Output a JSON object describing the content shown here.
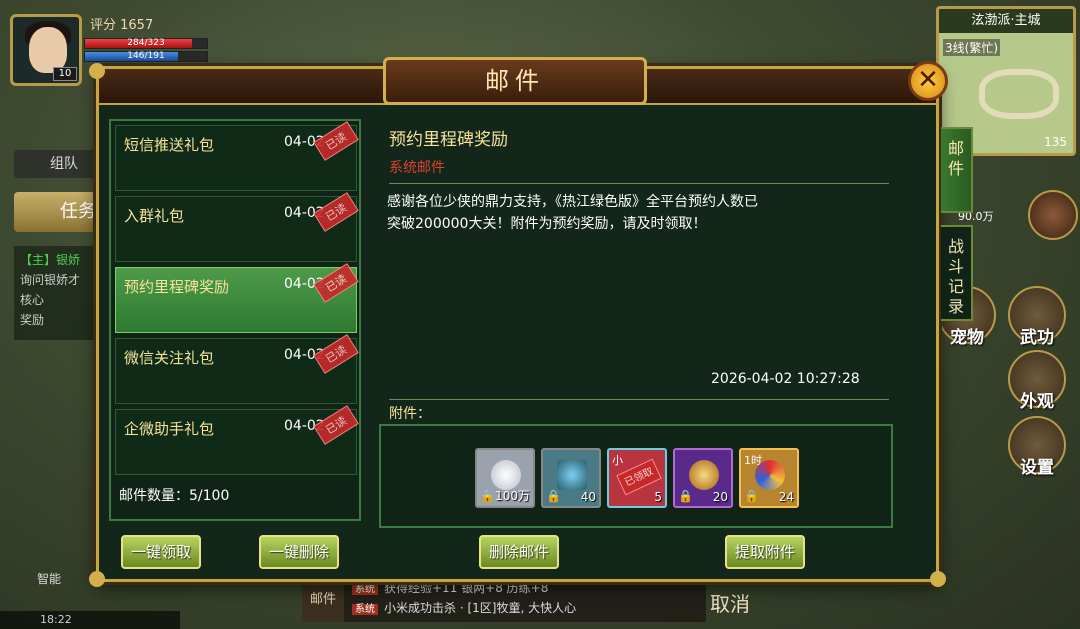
{
  "hud": {
    "score": "评分 1657",
    "hp": "284/323",
    "mp": "146/191",
    "level": "10",
    "team_tab": "组队",
    "quest_tab": "任务",
    "quest_line1_tag": "【主】银娇",
    "quest_line2": "询问银娇才",
    "quest_line3": "核心",
    "quest_line4": "奖励",
    "auto_label": "智能",
    "time": "18:22",
    "chat_tab": "邮件",
    "chat_line1_tag": "系统",
    "chat_line1": "获得经验+11 银两+8 历练+8",
    "chat_line2_tag": "系统",
    "chat_line2": "小米成功击杀 · [1区]牧童, 大快人心",
    "cancel": "取消",
    "pet_btn": "宠物",
    "skill_btn": "武功",
    "look_btn": "外观",
    "settings_btn": "设置",
    "bp_value": "90.0万"
  },
  "minimap": {
    "title": "泫渤派·主城",
    "line": "3线(繁忙)",
    "coords": "135"
  },
  "dialog": {
    "title": "邮件",
    "close_label": "✕",
    "tabs": [
      "邮件",
      "战斗记录"
    ],
    "mail_count": "邮件数量：5/100",
    "mails": [
      {
        "name": "短信推送礼包",
        "date": "04-02",
        "stamp": "已读"
      },
      {
        "name": "入群礼包",
        "date": "04-02",
        "stamp": "已读"
      },
      {
        "name": "预约里程碑奖励",
        "date": "04-02",
        "stamp": "已读"
      },
      {
        "name": "微信关注礼包",
        "date": "04-02",
        "stamp": "已读"
      },
      {
        "name": "企微助手礼包",
        "date": "04-02",
        "stamp": "已读"
      }
    ],
    "detail": {
      "title": "预约里程碑奖励",
      "tag": "系统邮件",
      "body_line1": "感谢各位少侠的鼎力支持，《热江绿色版》全平台预约人数已",
      "body_line2": "突破200000大关！附件为预约奖励，请及时领取！",
      "time": "2026-04-02  10:27:28",
      "attach_label": "附件："
    },
    "attachments": [
      {
        "icon": "silver-ingot-icon",
        "qty": "100万",
        "color": "#9aa2ad"
      },
      {
        "icon": "ghost-mask-icon",
        "qty": "40",
        "color": "#4a7a86"
      },
      {
        "icon": "red-gem-icon",
        "qty": "5",
        "top": "小",
        "claimed": "已领取",
        "color": "#b8343e"
      },
      {
        "icon": "gold-coin-icon",
        "qty": "20",
        "color": "#5a2a8a"
      },
      {
        "icon": "flame-swirl-icon",
        "qty": "24",
        "top": "1时",
        "color": "#b8842e"
      }
    ],
    "buttons": {
      "claim_all": "一键领取",
      "delete_all": "一键删除",
      "delete_mail": "删除邮件",
      "take_attach": "提取附件"
    }
  }
}
